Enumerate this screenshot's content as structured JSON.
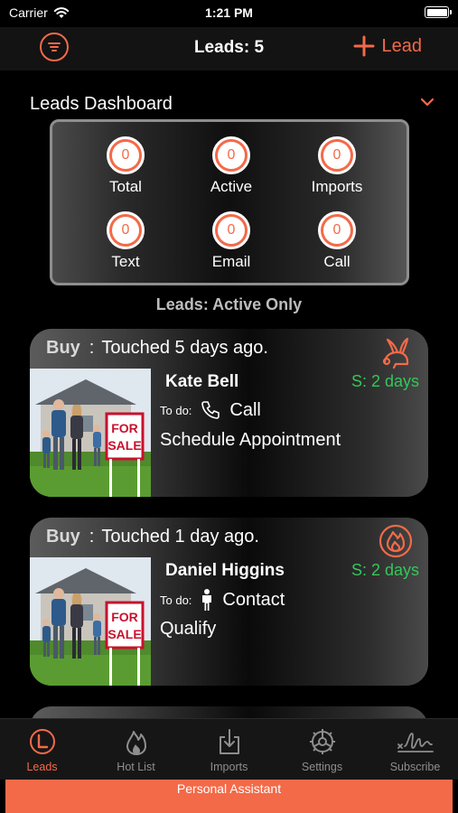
{
  "status": {
    "carrier": "Carrier",
    "time": "1:21 PM"
  },
  "nav": {
    "title": "Leads: 5",
    "add_label": "Lead"
  },
  "dashboard": {
    "title": "Leads Dashboard",
    "stats": [
      {
        "label": "Total",
        "value": "0"
      },
      {
        "label": "Active",
        "value": "0"
      },
      {
        "label": "Imports",
        "value": "0"
      },
      {
        "label": "Text",
        "value": "0"
      },
      {
        "label": "Email",
        "value": "0"
      },
      {
        "label": "Call",
        "value": "0"
      }
    ]
  },
  "filter_label": "Leads: Active Only",
  "leads": [
    {
      "type": "Buy",
      "separator": ":",
      "touched": "Touched 5 days ago.",
      "name": "Kate Bell",
      "stale": "S: 2 days",
      "todo_label": "To do:",
      "todo_value": "Call",
      "task": "Schedule Appointment",
      "type_icon": "rabbit-icon",
      "todo_icon": "phone-icon",
      "photo_sign": [
        "FOR",
        "SALE"
      ]
    },
    {
      "type": "Buy",
      "separator": ":",
      "touched": "Touched 1 day ago.",
      "name": "Daniel Higgins",
      "stale": "S: 2 days",
      "todo_label": "To do:",
      "todo_value": "Contact",
      "task": "Qualify",
      "type_icon": "flame-icon",
      "todo_icon": "person-icon",
      "photo_sign": [
        "FOR",
        "SALE"
      ]
    }
  ],
  "tabs": [
    {
      "label": "Leads",
      "icon": "leads-circle-icon",
      "active": true
    },
    {
      "label": "Hot List",
      "icon": "flame-icon"
    },
    {
      "label": "Imports",
      "icon": "import-icon"
    },
    {
      "label": "Settings",
      "icon": "gear-icon"
    },
    {
      "label": "Subscribe",
      "icon": "signature-icon"
    }
  ],
  "assistant_label": "Personal Assistant",
  "colors": {
    "accent": "#f36a49",
    "stale_green": "#34c759",
    "background": "#000000"
  }
}
